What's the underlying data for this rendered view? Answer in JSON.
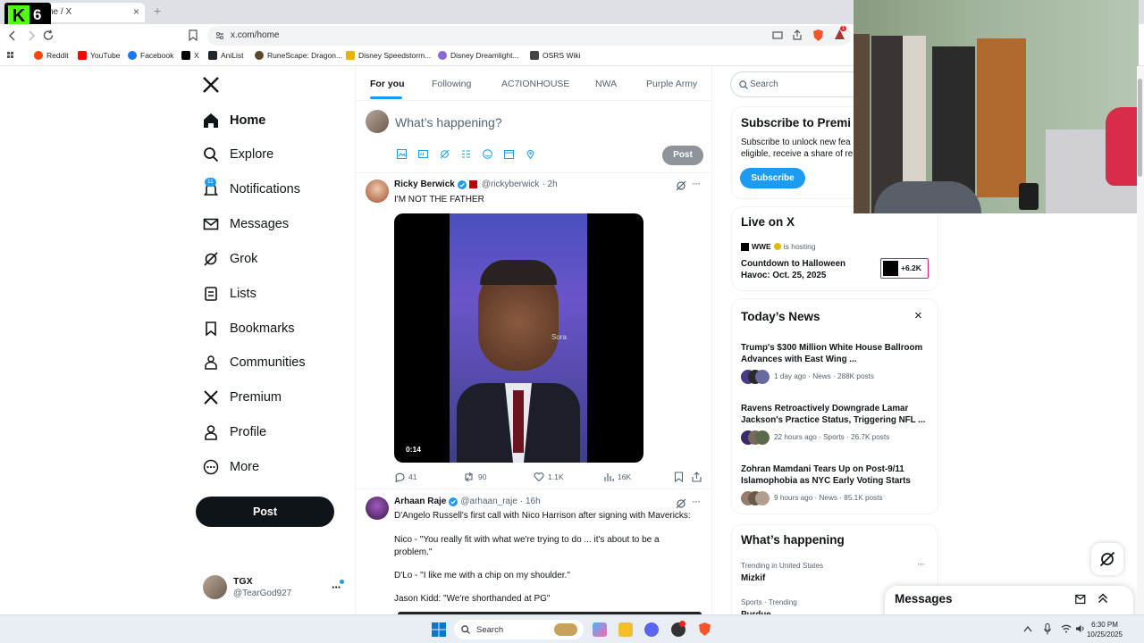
{
  "browser": {
    "tab_title": "ne / X",
    "close_symbol": "×",
    "new_tab_symbol": "+",
    "url": "x.com/home",
    "brave_badge_count": "1",
    "bookmarks": [
      "Reddit",
      "YouTube",
      "Facebook",
      "X",
      "AniList",
      "RuneScape: Dragon...",
      "Disney Speedstorm...",
      "Disney Dreamlight...",
      "OSRS Wiki"
    ]
  },
  "kick_badge": {
    "logo": "K",
    "count": "6"
  },
  "nav": {
    "items": [
      "Home",
      "Explore",
      "Notifications",
      "Messages",
      "Grok",
      "Lists",
      "Bookmarks",
      "Communities",
      "Premium",
      "Profile",
      "More"
    ],
    "notifications_badge": "11",
    "post_label": "Post"
  },
  "account": {
    "name": "TGX",
    "handle": "@TearGod927"
  },
  "feed": {
    "tabs": [
      "For you",
      "Following",
      "AC7IONHOUSE",
      "NWA",
      "Purple Army"
    ],
    "compose_placeholder": "What’s happening?",
    "compose_post_label": "Post",
    "tweets": [
      {
        "name": "Ricky Berwick",
        "handle": "@rickyberwick",
        "time": "· 2h",
        "text": "I'M NOT THE FATHER",
        "video_time": "0:14",
        "watermark": "Sora",
        "replies": "41",
        "reposts": "90",
        "likes": "1.1K",
        "views": "16K"
      },
      {
        "name": "Arhaan Raje",
        "handle": "@arhaan_raje",
        "time": "· 16h",
        "lines": [
          "D'Angelo Russell's first call with Nico Harrison after signing with Mavericks:",
          "Nico - \"You really fit with what we're trying to do ... it's about to be a problem.\"",
          "D'Lo - \"I like me with a chip on my shoulder.\"",
          "Jason Kidd: \"We're shorthanded at PG\""
        ]
      }
    ]
  },
  "right": {
    "search_placeholder": "Search",
    "premium": {
      "title": "Subscribe to Premi",
      "body_line1": "Subscribe to unlock new fea",
      "body_line2": "eligible, receive a share of re",
      "button": "Subscribe"
    },
    "live": {
      "title": "Live on X",
      "host": "WWE",
      "hosting": "is hosting",
      "event": "Countdown to Halloween Havoc: Oct. 25, 2025",
      "viewers": "+6.2K"
    },
    "news": {
      "title": "Today’s News",
      "close_symbol": "×",
      "items": [
        {
          "headline": "Trump's $300 Million White House Ballroom Advances with East Wing ...",
          "meta": "1 day ago · News · 288K posts"
        },
        {
          "headline": "Ravens Retroactively Downgrade Lamar Jackson's Practice Status, Triggering NFL ...",
          "meta": "22 hours ago · Sports · 26.7K posts"
        },
        {
          "headline": "Zohran Mamdani Tears Up on Post-9/11 Islamophobia as NYC Early Voting Starts",
          "meta": "9 hours ago · News · 85.1K posts"
        }
      ]
    },
    "happening": {
      "title": "What’s happening",
      "trend1_context": "Trending in United States",
      "trend1_name": "Mizkif",
      "trend2_context": "Sports · Trending",
      "trend2_name": "Purdue"
    },
    "messages_label": "Messages"
  },
  "taskbar": {
    "search_label": "Search",
    "time": "6:30 PM",
    "date": "10/25/2025"
  },
  "colors": {
    "x_blue": "#1d9bf0",
    "kick_green": "#53fc18",
    "text": "#0f1419",
    "muted": "#536471"
  }
}
